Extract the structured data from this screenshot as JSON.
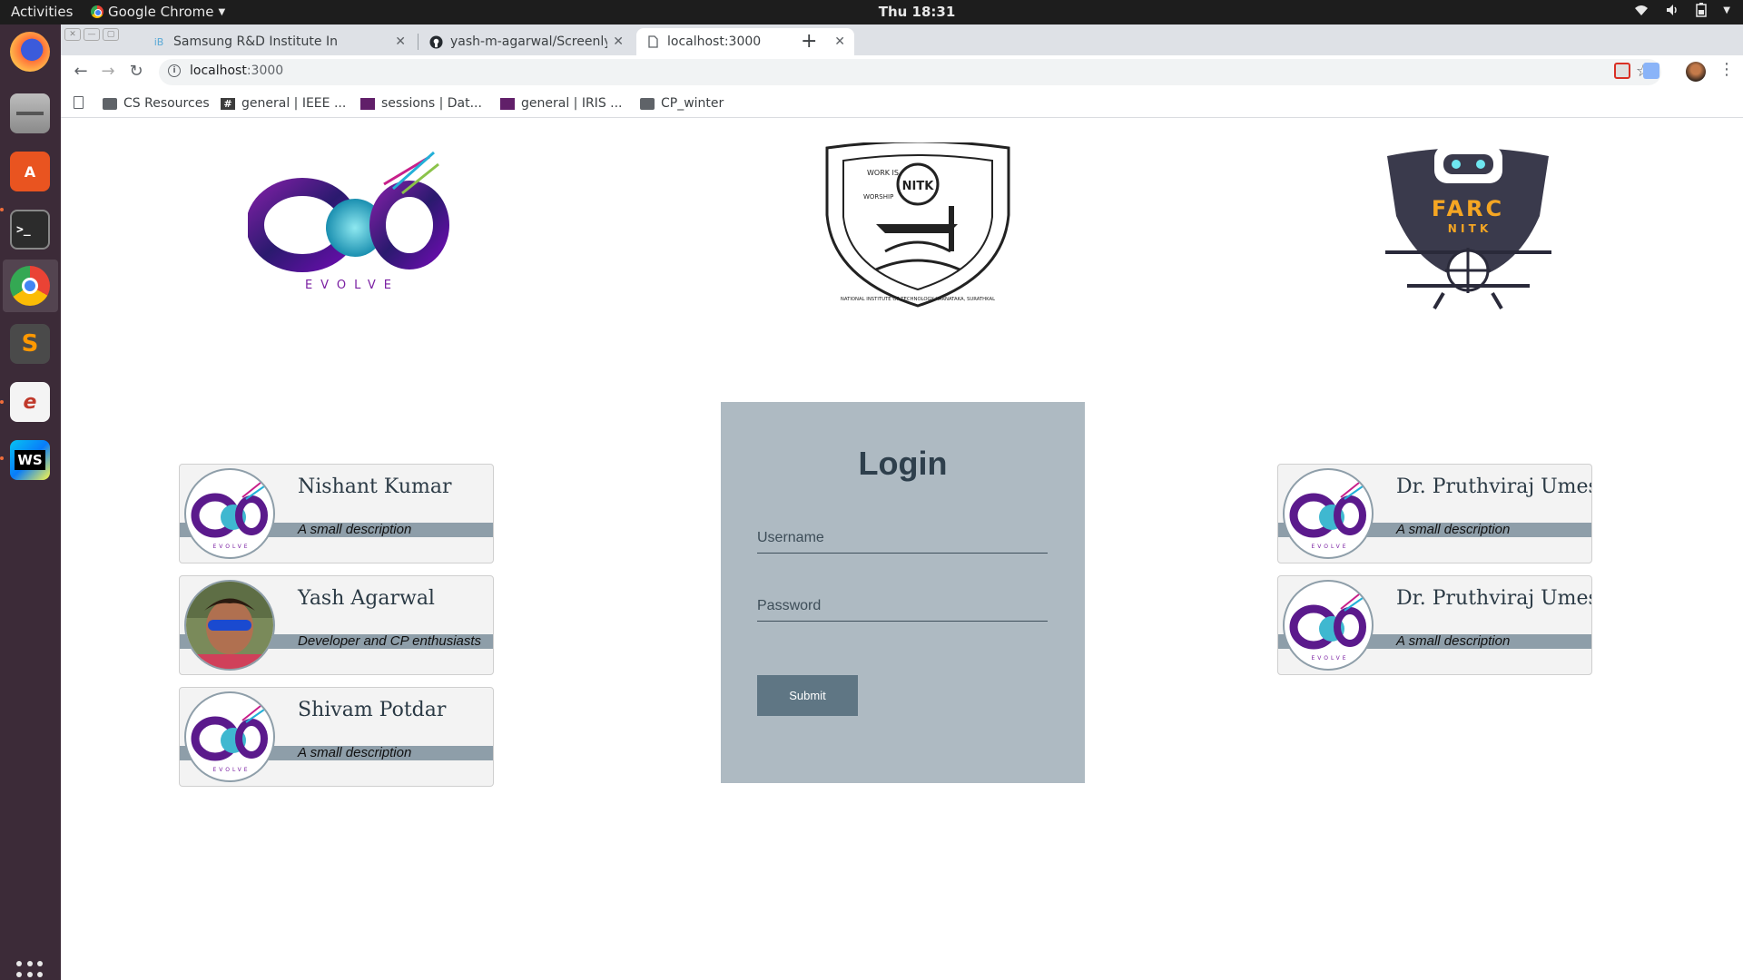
{
  "topbar": {
    "activities": "Activities",
    "app_name": "Google Chrome",
    "clock": "Thu 18:31"
  },
  "tabs": [
    {
      "title": "Samsung R&D Institute In",
      "active": false
    },
    {
      "title": "yash-m-agarwal/Screenly",
      "active": false
    },
    {
      "title": "localhost:3000",
      "active": true
    }
  ],
  "toolbar": {
    "url_host": "localhost",
    "url_port": ":3000"
  },
  "bookmarks": [
    {
      "label": "CS Resources",
      "icon": "folder-icon"
    },
    {
      "label": "general | IEEE ...",
      "icon": "hash-icon"
    },
    {
      "label": "sessions | Dat...",
      "icon": "slack-icon"
    },
    {
      "label": "general | IRIS ...",
      "icon": "slack-icon"
    },
    {
      "label": "CP_winter",
      "icon": "folder-icon"
    }
  ],
  "logos": {
    "evolve_text": "EVOLVE",
    "nitk_motto_left": "WORK IS",
    "nitk_motto_left2": "WORSHIP",
    "nitk_ring": "NATIONAL INSTITUTE OF TECHNOLOGY KARNATAKA, SURATHKAL",
    "nitk_center": "NITK",
    "farc_title": "FARC",
    "farc_sub": "N I T K"
  },
  "left_cards": [
    {
      "name": "Nishant Kumar",
      "description": "A small description",
      "avatar": "evolve-avatar"
    },
    {
      "name": "Yash Agarwal",
      "description": "Developer and CP enthusiasts",
      "avatar": "photo-avatar"
    },
    {
      "name": "Shivam Potdar",
      "description": "A small description",
      "avatar": "evolve-avatar"
    }
  ],
  "right_cards": [
    {
      "name": "Dr. Pruthviraj Umesh",
      "description": "A small description",
      "avatar": "evolve-avatar"
    },
    {
      "name": "Dr. Pruthviraj Umesh",
      "description": "A small description",
      "avatar": "evolve-avatar"
    }
  ],
  "login": {
    "heading": "Login",
    "username_placeholder": "Username",
    "password_placeholder": "Password",
    "submit_label": "Submit"
  },
  "colors": {
    "login_bg": "#aebac2",
    "card_band": "#8e9ea9",
    "submit_bg": "#5f7684",
    "heading": "#2e3f4c"
  }
}
